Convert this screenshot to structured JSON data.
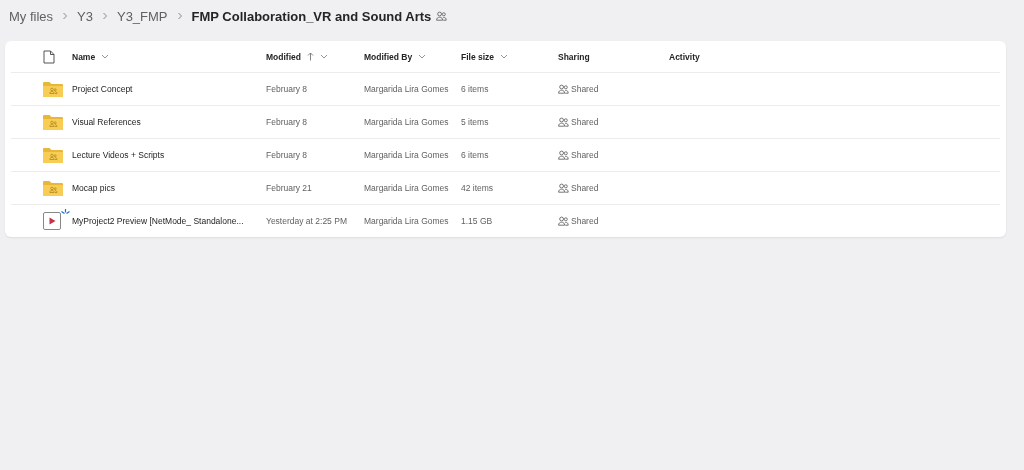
{
  "breadcrumb": [
    {
      "label": "My files",
      "current": false,
      "shared": false
    },
    {
      "label": "Y3",
      "current": false,
      "shared": false
    },
    {
      "label": "Y3_FMP",
      "current": false,
      "shared": false
    },
    {
      "label": "FMP Collaboration_VR and Sound Arts",
      "current": true,
      "shared": true
    }
  ],
  "table": {
    "columns": [
      {
        "label": "Name",
        "sorted": false,
        "has_menu": true
      },
      {
        "label": "Modified",
        "sorted": true,
        "has_menu": true
      },
      {
        "label": "Modified By",
        "sorted": false,
        "has_menu": true
      },
      {
        "label": "File size",
        "sorted": false,
        "has_menu": true
      },
      {
        "label": "Sharing",
        "sorted": false,
        "has_menu": false
      },
      {
        "label": "Activity",
        "sorted": false,
        "has_menu": false
      }
    ],
    "rows": [
      {
        "kind": "folder",
        "new": false,
        "name": "Project Concept",
        "modified": "February 8",
        "modified_by": "Margarida Lira Gomes",
        "size": "6 items",
        "sharing": "Shared"
      },
      {
        "kind": "folder",
        "new": false,
        "name": "Visual References",
        "modified": "February 8",
        "modified_by": "Margarida Lira Gomes",
        "size": "5 items",
        "sharing": "Shared"
      },
      {
        "kind": "folder",
        "new": false,
        "name": "Lecture Videos + Scripts",
        "modified": "February 8",
        "modified_by": "Margarida Lira Gomes",
        "size": "6 items",
        "sharing": "Shared"
      },
      {
        "kind": "folder",
        "new": false,
        "name": "Mocap pics",
        "modified": "February 21",
        "modified_by": "Margarida Lira Gomes",
        "size": "42 items",
        "sharing": "Shared"
      },
      {
        "kind": "video",
        "new": true,
        "name": "MyProject2 Preview [NetMode_ Standalone...",
        "modified": "Yesterday at 2:25 PM",
        "modified_by": "Margarida Lira Gomes",
        "size": "1.15 GB",
        "sharing": "Shared"
      }
    ]
  }
}
